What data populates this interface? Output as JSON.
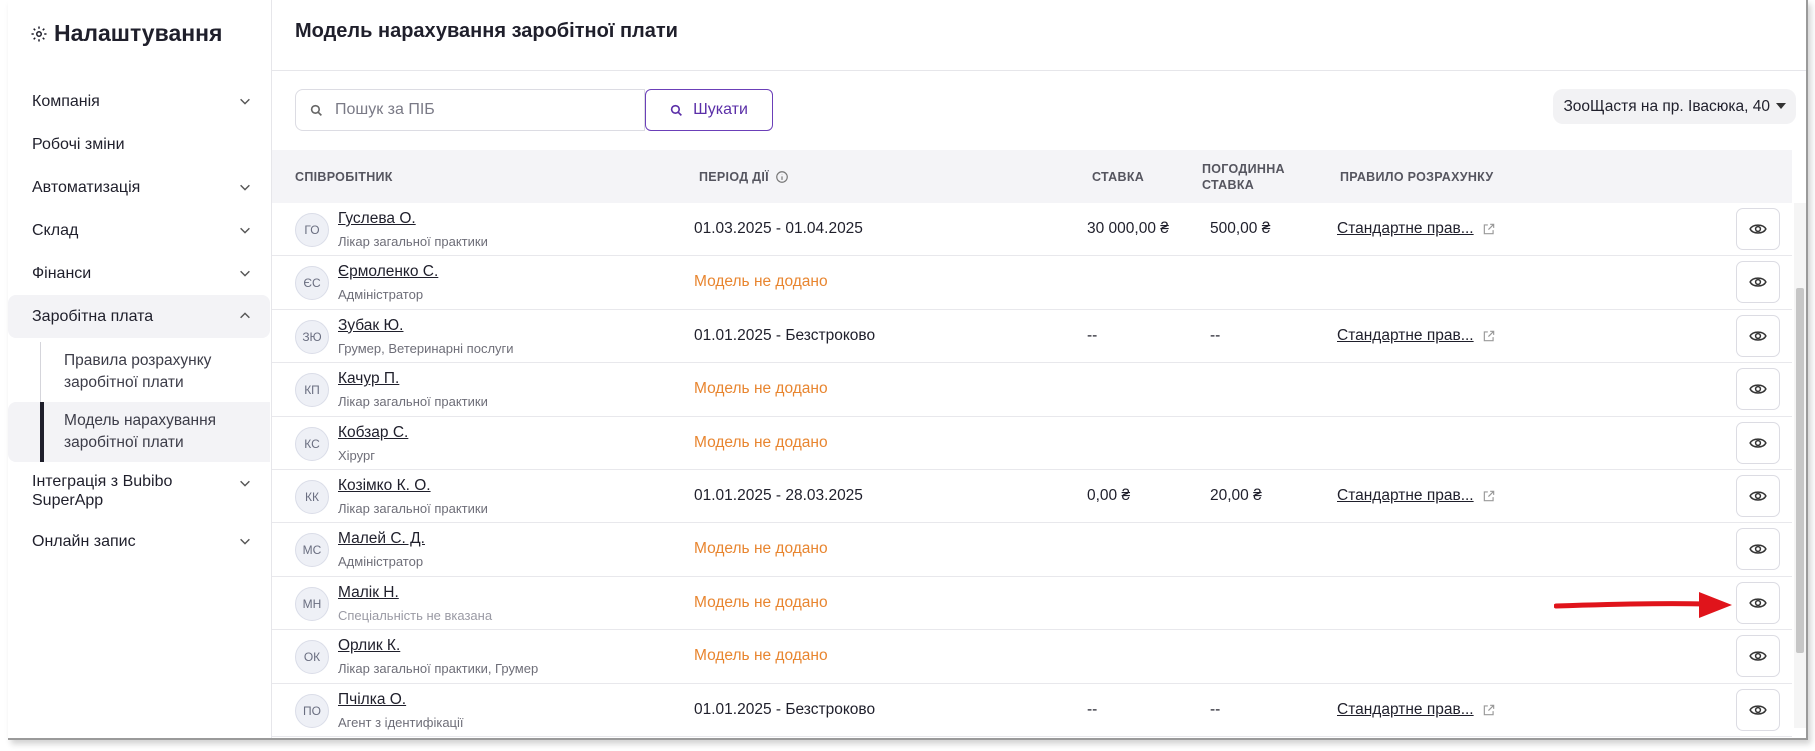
{
  "sidebar": {
    "title": "Налаштування",
    "items": [
      {
        "label": "Компанія",
        "chevron": "down"
      },
      {
        "label": "Робочі зміни",
        "chevron": "none"
      },
      {
        "label": "Автоматизація",
        "chevron": "down"
      },
      {
        "label": "Склад",
        "chevron": "down"
      },
      {
        "label": "Фінанси",
        "chevron": "down"
      },
      {
        "label": "Заробітна плата",
        "chevron": "up",
        "expanded": true,
        "children": [
          {
            "label": "Правила розрахунку заробітної плати",
            "active": false
          },
          {
            "label": "Модель нарахування заробітної плати",
            "active": true
          }
        ]
      },
      {
        "label": "Інтеграція з Bubibo SuperApp",
        "chevron": "down"
      },
      {
        "label": "Онлайн запис",
        "chevron": "down"
      }
    ]
  },
  "header": {
    "title": "Модель нарахування заробітної плати"
  },
  "search": {
    "placeholder": "Пошук за ПІБ",
    "value": "",
    "button_label": "Шукати"
  },
  "clinic_select": {
    "value": "ЗооЩастя на пр. Івасюка, 40"
  },
  "table": {
    "columns": {
      "employee": "СПІВРОБІТНИК",
      "period": "ПЕРІОД ДІЇ",
      "rate": "СТАВКА",
      "hourly_rate": "ПОГОДИННА СТАВКА",
      "rule": "ПРАВИЛО РОЗРАХУНКУ"
    },
    "rows": [
      {
        "initials": "ГО",
        "name": "Гуслева О.",
        "specialty": "Лікар загальної практики",
        "period": "01.03.2025 - 01.04.2025",
        "has_model": true,
        "rate": "30 000,00 ₴",
        "hourly_rate": "500,00 ₴",
        "rule": "Стандартне прав..."
      },
      {
        "initials": "ЄС",
        "name": "Єрмоленко С.",
        "specialty": "Адміністратор",
        "period": "Модель не додано",
        "has_model": false,
        "rate": "",
        "hourly_rate": "",
        "rule": ""
      },
      {
        "initials": "ЗЮ",
        "name": "Зубак Ю.",
        "specialty": "Грумер, Ветеринарні послуги",
        "period": "01.01.2025 - Безстроково",
        "has_model": true,
        "rate": "--",
        "hourly_rate": "--",
        "rule": "Стандартне прав..."
      },
      {
        "initials": "КП",
        "name": "Качур П.",
        "specialty": "Лікар загальної практики",
        "period": "Модель не додано",
        "has_model": false,
        "rate": "",
        "hourly_rate": "",
        "rule": ""
      },
      {
        "initials": "КС",
        "name": "Кобзар С.",
        "specialty": "Хірург",
        "period": "Модель не додано",
        "has_model": false,
        "rate": "",
        "hourly_rate": "",
        "rule": ""
      },
      {
        "initials": "КК",
        "name": "Козімко К. О.",
        "specialty": "Лікар загальної практики",
        "period": "01.01.2025 - 28.03.2025",
        "has_model": true,
        "rate": "0,00 ₴",
        "hourly_rate": "20,00 ₴",
        "rule": "Стандартне прав..."
      },
      {
        "initials": "МС",
        "name": "Малей С. Д.",
        "specialty": "Адміністратор",
        "period": "Модель не додано",
        "has_model": false,
        "rate": "",
        "hourly_rate": "",
        "rule": ""
      },
      {
        "initials": "МН",
        "name": "Малік Н.",
        "specialty": "Спеціальність не вказана",
        "specialty_muted": true,
        "period": "Модель не додано",
        "has_model": false,
        "rate": "",
        "hourly_rate": "",
        "rule": ""
      },
      {
        "initials": "ОК",
        "name": "Орлик К.",
        "specialty": "Лікар загальної практики, Грумер",
        "period": "Модель не додано",
        "has_model": false,
        "rate": "",
        "hourly_rate": "",
        "rule": ""
      },
      {
        "initials": "ПО",
        "name": "Пчілка О.",
        "specialty": "Агент з ідентифікації",
        "period": "01.01.2025 - Безстроково",
        "has_model": true,
        "rate": "--",
        "hourly_rate": "--",
        "rule": "Стандартне прав..."
      }
    ]
  },
  "colors": {
    "accent": "#6b3fb8",
    "warning": "#e8852f",
    "annotation_arrow": "#e0141b"
  },
  "icons": {
    "title": "gear-icon",
    "search": "search-icon",
    "row_action": "eye-icon",
    "rule_link": "external-link-icon",
    "period_info": "info-icon"
  }
}
